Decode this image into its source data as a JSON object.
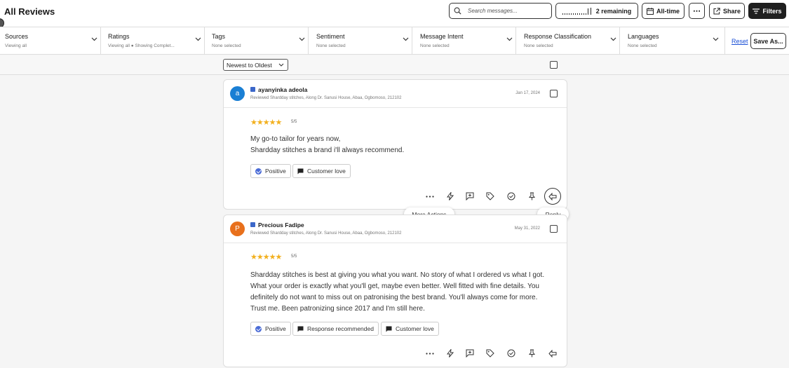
{
  "header": {
    "title": "All Reviews",
    "search_placeholder": "Search messages...",
    "remaining_label": "2 remaining",
    "date_range_label": "All-time",
    "more_label": "⋯",
    "share_label": "Share",
    "filters_label": "Filters"
  },
  "filters": [
    {
      "title": "Sources",
      "subtitle": "Viewing all"
    },
    {
      "title": "Ratings",
      "subtitle": "Viewing all ● Showing Complet..."
    },
    {
      "title": "Tags",
      "subtitle": "None selected"
    },
    {
      "title": "Sentiment",
      "subtitle": "None selected"
    },
    {
      "title": "Message Intent",
      "subtitle": "None selected"
    },
    {
      "title": "Response Classification",
      "subtitle": "None selected"
    },
    {
      "title": "Languages",
      "subtitle": "None selected"
    }
  ],
  "filter_actions": {
    "reset_label": "Reset",
    "save_as_label": "Save As..."
  },
  "sort": {
    "selected": "Newest to Oldest"
  },
  "reviews": [
    {
      "avatar_letter": "a",
      "avatar_color": "#1a7fd4",
      "author": "ayanyinka adeola",
      "location": "Reviewed Shardday stitches, Along Dr. Sanusi House, Abaa, Ogbomoso, 212102",
      "date": "Jan 17, 2024",
      "stars": "★★★★★",
      "rating_label": "5/5",
      "text": "My go-to tailor for years now,\nShardday stitches a brand i'll always recommend.",
      "tags": [
        "Positive",
        "Customer love"
      ]
    },
    {
      "avatar_letter": "P",
      "avatar_color": "#e8701c",
      "author": "Precious Fadipe",
      "location": "Reviewed Shardday stitches, Along Dr. Sanusi House, Abaa, Ogbomoso, 212102",
      "date": "May 31, 2022",
      "stars": "★★★★★",
      "rating_label": "5/5",
      "text": "Shardday stitches is best at giving you what you want. No story of what I ordered vs what I got. What your order is exactly what you'll get, maybe even better. Well fitted with fine details. You definitely do not want to miss out on patronising the best brand. You'll always come for more. Trust me. Been patronizing since 2017 and I'm still here.",
      "tags": [
        "Positive",
        "Response recommended",
        "Customer love"
      ]
    }
  ],
  "tooltips": {
    "more_actions": "More Actions",
    "reply": "Reply"
  },
  "colors": {
    "accent_dark": "#1f1f1f",
    "star": "#f2b01e",
    "link": "#1a4fd6",
    "positive": "#4a6bd6"
  }
}
